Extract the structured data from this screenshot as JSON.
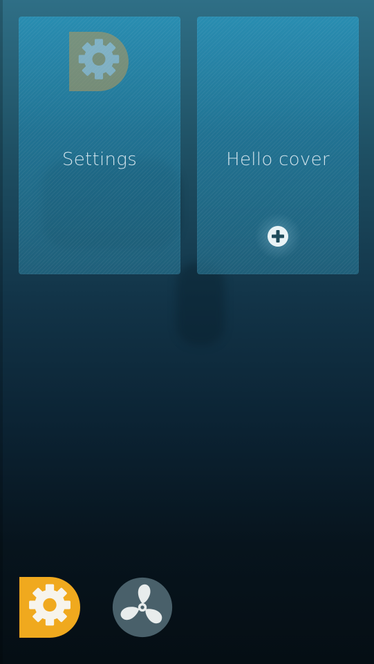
{
  "covers": [
    {
      "title": "Settings",
      "icon": "gear-icon"
    },
    {
      "title": "Hello cover",
      "action_icon": "plus-icon"
    }
  ],
  "launcher": [
    {
      "icon": "settings-gear-icon",
      "color": "#f0a91e"
    },
    {
      "icon": "fan-icon",
      "color": "#49606a"
    }
  ],
  "colors": {
    "cover_bg": "#2585a8",
    "cover_text": "#e1eef4",
    "background_top": "#2f6f86",
    "background_bottom": "#050e14"
  }
}
